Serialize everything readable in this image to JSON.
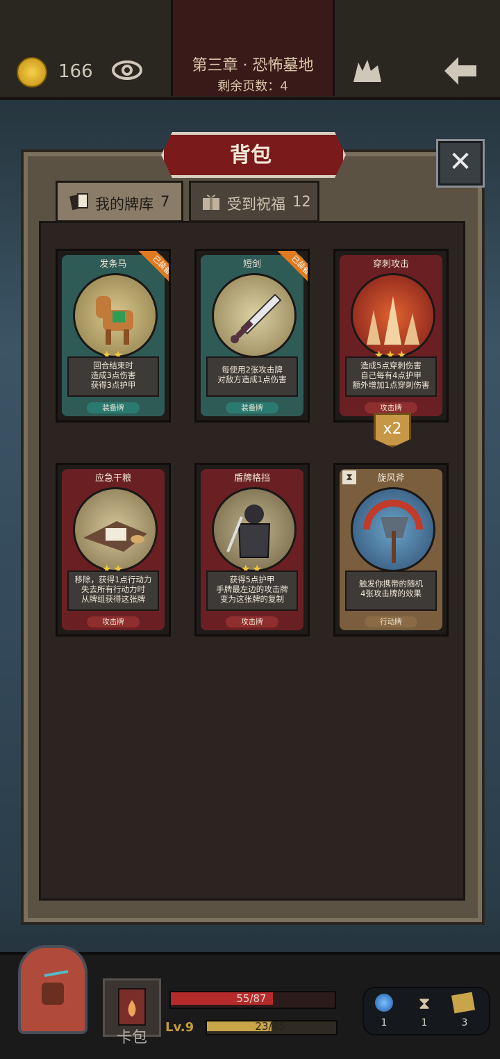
{
  "top": {
    "coins": "166",
    "chapter_title": "第三章 · 恐怖墓地",
    "pages_left": "剩余页数：4"
  },
  "panel": {
    "title": "背包",
    "tabs": [
      {
        "label": "我的牌库",
        "count": "7"
      },
      {
        "label": "受到祝福",
        "count": "12"
      }
    ]
  },
  "cards": [
    {
      "name": "发条马",
      "desc": [
        "回合结束时",
        "造成3点伤害",
        "获得3点护甲"
      ],
      "type": "装备牌",
      "stars": "★★",
      "equipped": "已装备",
      "color": "teal"
    },
    {
      "name": "短剑",
      "desc": [
        "每使用2张攻击牌",
        "对敌方造成1点伤害"
      ],
      "type": "装备牌",
      "stars": "",
      "equipped": "已装备",
      "color": "teal"
    },
    {
      "name": "穿刺攻击",
      "desc": [
        "造成5点穿刺伤害",
        "自己每有4点护甲",
        "额外增加1点穿刺伤害"
      ],
      "type": "攻击牌",
      "stars": "★★★",
      "badge": "x2",
      "color": "red"
    },
    {
      "name": "应急干粮",
      "desc": [
        "移除，获得1点行动力",
        "失去所有行动力时",
        "从牌组获得这张牌"
      ],
      "type": "攻击牌",
      "stars": "★★",
      "color": "red"
    },
    {
      "name": "盾牌格挡",
      "desc": [
        "获得5点护甲",
        "手牌最左边的攻击牌",
        "变为这张牌的复制"
      ],
      "type": "攻击牌",
      "stars": "★★",
      "color": "red"
    },
    {
      "name": "旋风斧",
      "desc": [
        "触发你携带的随机",
        "4张攻击牌的效果"
      ],
      "type": "行动牌",
      "stars": "",
      "color": "tan"
    }
  ],
  "bottom": {
    "card_pack_label": "卡包",
    "hp": "55/87",
    "hp_fraction": 0.632,
    "level": "Lv.9",
    "xp": "23/45",
    "xp_fraction": 0.511,
    "items": [
      "1",
      "1",
      "3"
    ]
  },
  "icons": [
    "coin-icon",
    "eye-icon",
    "monster-icon",
    "back-arrow-icon",
    "close-icon",
    "deck-icon",
    "gift-icon",
    "orb-icon",
    "hourglass-icon",
    "cards-icon"
  ]
}
